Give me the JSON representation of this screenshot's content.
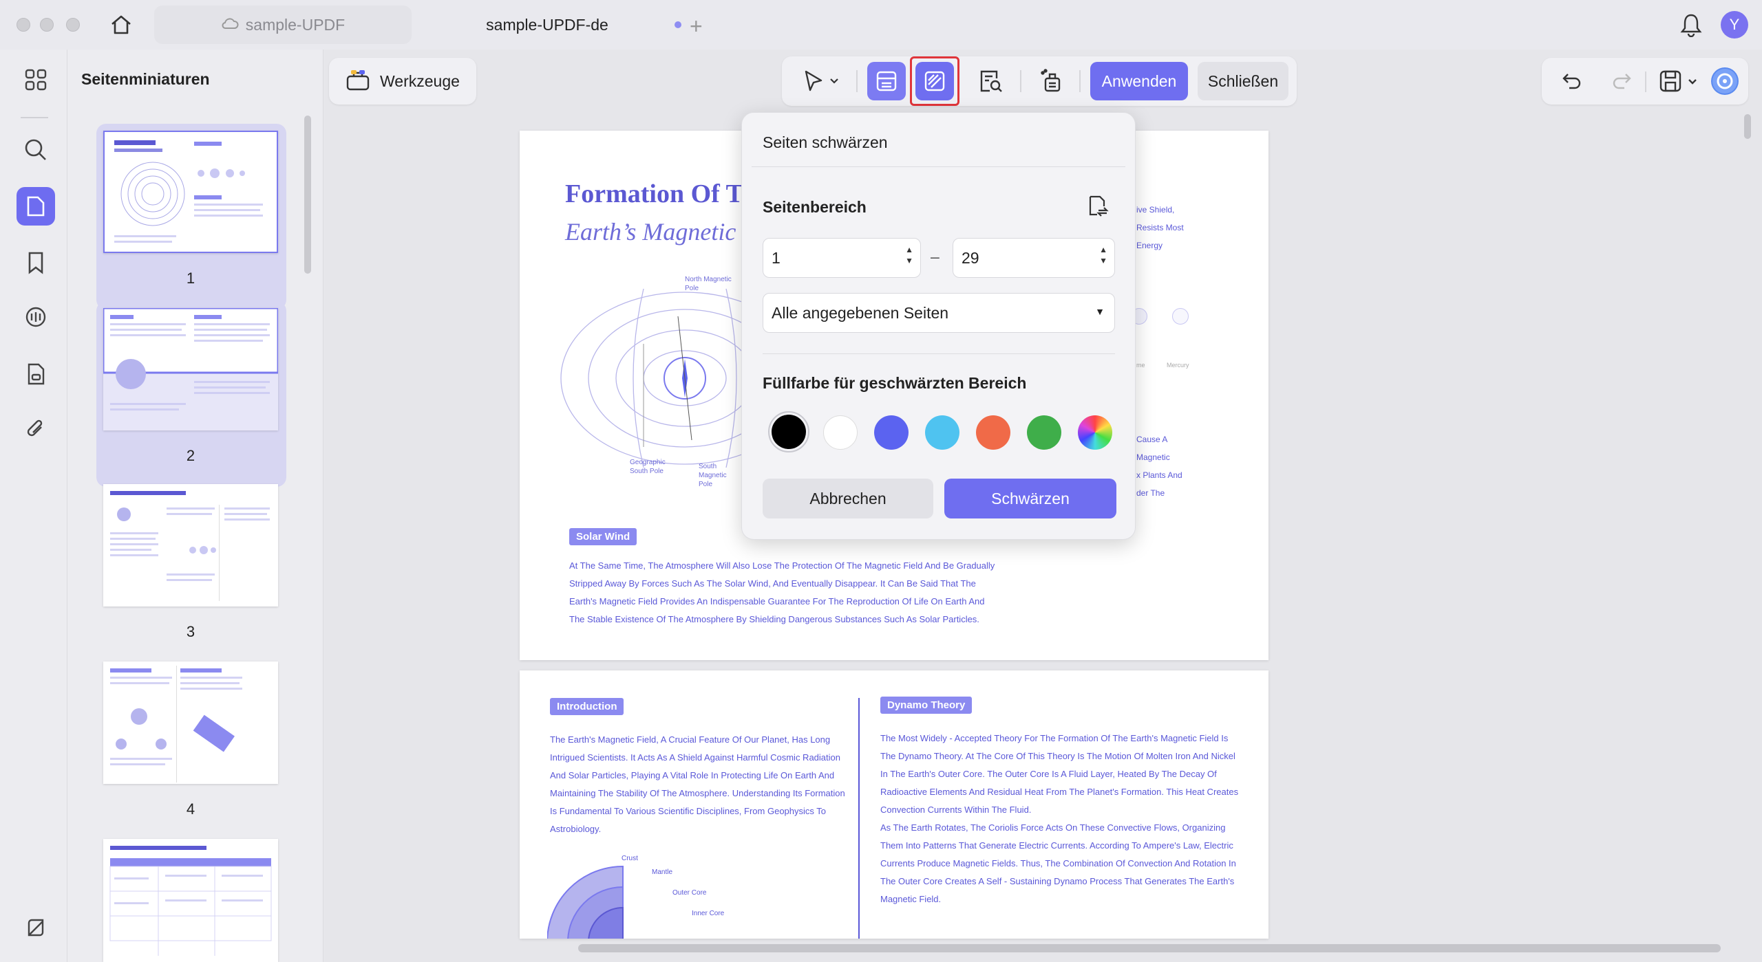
{
  "tabs": {
    "tab1": "sample-UPDF",
    "tab2": "sample-UPDF-de"
  },
  "avatar_letter": "Y",
  "thumb_panel": {
    "title": "Seitenminiaturen",
    "pages": [
      "1",
      "2",
      "3",
      "4"
    ]
  },
  "toolbar": {
    "tools_label": "Werkzeuge",
    "apply_label": "Anwenden",
    "close_label": "Schließen"
  },
  "popup": {
    "title": "Seiten schwärzen",
    "range_label": "Seitenbereich",
    "from_value": "1",
    "to_value": "29",
    "dash": "–",
    "select_value": "Alle angegebenen Seiten",
    "fill_label": "Füllfarbe für geschwärzten Bereich",
    "swatches": [
      "#000000",
      "#ffffff",
      "#5b63f0",
      "#4fc3f0",
      "#f06a48",
      "#3fae4a",
      "rainbow"
    ],
    "cancel_label": "Abbrechen",
    "confirm_label": "Schwärzen"
  },
  "page1": {
    "title_line1": "Formation Of T",
    "title_line2": "Earth’s Magnetic",
    "north_pole": "North Magnetic Pole",
    "geo_south": "Geographic South Pole",
    "south_mag": "South Magnetic Pole",
    "right_text": [
      "ive Shield,",
      "Resists Most",
      "Energy"
    ],
    "right_text2": [
      "Cause A",
      "Magnetic",
      "x Plants And",
      "der The"
    ],
    "small_labels": [
      "me",
      "Mercury"
    ],
    "solar_wind": "Solar Wind",
    "body": [
      "At The Same Time, The Atmosphere Will Also Lose The Protection Of The Magnetic Field And Be Gradually",
      "Stripped Away By Forces Such As The Solar Wind, And Eventually Disappear. It Can Be Said That The",
      "Earth's Magnetic Field Provides An Indispensable Guarantee For The Reproduction Of Life On Earth And",
      "The Stable Existence Of The Atmosphere By Shielding Dangerous Substances Such As Solar Particles."
    ]
  },
  "page2": {
    "intro_head": "Introduction",
    "intro_body": [
      "The Earth's Magnetic Field, A Crucial Feature Of Our Planet, Has Long",
      "Intrigued Scientists. It Acts As A Shield Against Harmful Cosmic Radiation",
      "And Solar Particles, Playing A Vital Role In Protecting Life On Earth And",
      "Maintaining The Stability Of The Atmosphere. Understanding Its Formation",
      "Is Fundamental To Various Scientific Disciplines, From Geophysics To",
      "Astrobiology."
    ],
    "dynamo_head": "Dynamo Theory",
    "dynamo_body": [
      "The Most Widely - Accepted Theory For The Formation Of The Earth's Magnetic Field Is",
      "The Dynamo Theory. At The Core Of This Theory Is The Motion Of Molten Iron And Nickel",
      "In The Earth's Outer Core. The Outer Core Is A Fluid Layer, Heated By The Decay Of",
      "Radioactive Elements And Residual Heat From The Planet's Formation. This Heat Creates",
      "Convection Currents Within The Fluid.",
      "As The Earth Rotates, The Coriolis Force Acts On These Convective Flows, Organizing",
      "Them Into Patterns That Generate Electric Currents. According To Ampere's Law, Electric",
      "Currents Produce Magnetic Fields. Thus, The Combination Of Convection And Rotation In",
      "The Outer Core Creates A Self - Sustaining Dynamo Process That Generates The Earth's",
      "Magnetic Field."
    ],
    "layers": [
      "Crust",
      "Mantle",
      "Outer Core",
      "Inner Core"
    ]
  }
}
